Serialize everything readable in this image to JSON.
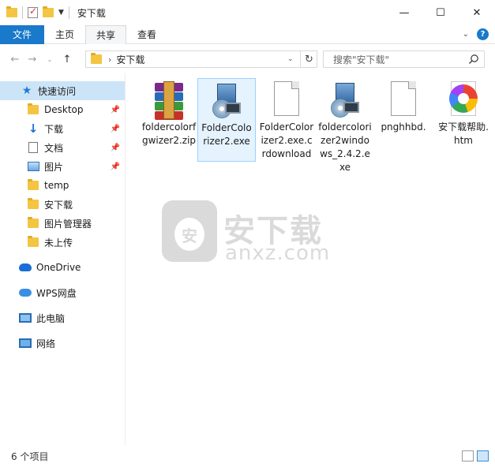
{
  "window": {
    "title": "安下载",
    "controls": {
      "minimize": "—",
      "maximize": "☐",
      "close": "✕"
    }
  },
  "ribbon": {
    "tabs": [
      {
        "label": "文件",
        "style": "file"
      },
      {
        "label": "主页"
      },
      {
        "label": "共享",
        "active": true
      },
      {
        "label": "查看"
      }
    ],
    "help_label": "?"
  },
  "address": {
    "path": "安下载",
    "search_placeholder": "搜索\"安下载\""
  },
  "sidebar": {
    "items": [
      {
        "label": "快速访问",
        "icon": "star-icon",
        "selected": true
      },
      {
        "label": "Desktop",
        "icon": "folder-icon",
        "pinned": true
      },
      {
        "label": "下载",
        "icon": "download-icon",
        "pinned": true
      },
      {
        "label": "文档",
        "icon": "document-icon",
        "pinned": true
      },
      {
        "label": "图片",
        "icon": "pictures-icon",
        "pinned": true
      },
      {
        "label": "temp",
        "icon": "folder-icon"
      },
      {
        "label": "安下载",
        "icon": "folder-icon"
      },
      {
        "label": "图片管理器",
        "icon": "folder-icon"
      },
      {
        "label": "未上传",
        "icon": "folder-icon"
      },
      {
        "label": "OneDrive",
        "icon": "onedrive-icon"
      },
      {
        "label": "WPS网盘",
        "icon": "wps-cloud-icon"
      },
      {
        "label": "此电脑",
        "icon": "computer-icon"
      },
      {
        "label": "网络",
        "icon": "network-icon"
      }
    ]
  },
  "files": [
    {
      "name": "foldercolorfgwizer2.zip",
      "icon": "winrar-archive-icon"
    },
    {
      "name": "FolderColorizer2.exe",
      "icon": "installer-icon",
      "selected": true
    },
    {
      "name": "FolderColorizer2.exe.crdownload",
      "icon": "blank-file-icon"
    },
    {
      "name": "foldercolorizer2windows_2.4.2.exe",
      "icon": "installer-icon"
    },
    {
      "name": "pnghhbd.",
      "icon": "blank-file-icon"
    },
    {
      "name": "安下载帮助.htm",
      "icon": "chromium-html-icon"
    }
  ],
  "watermark": {
    "cn": "安下载",
    "en": "anxz.com",
    "badge": "安"
  },
  "status": {
    "items_count": "6 个项目"
  },
  "colors": {
    "accent": "#1979ca",
    "selection": "#cce4f7",
    "file_selection": "#e5f3ff"
  }
}
